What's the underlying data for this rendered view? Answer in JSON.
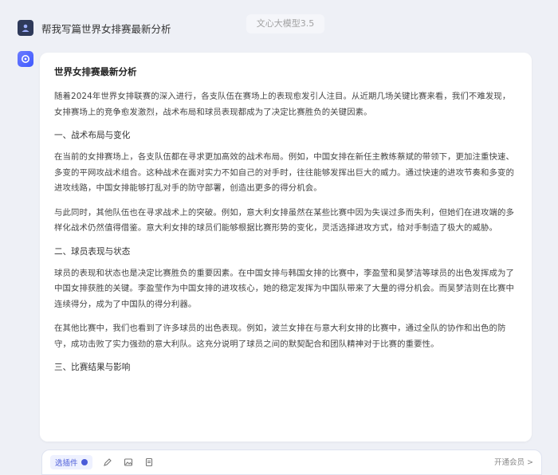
{
  "header": {
    "model_label": "文心大模型3.5"
  },
  "user": {
    "prompt": "帮我写篇世界女排赛最新分析"
  },
  "response": {
    "title": "世界女排赛最新分析",
    "intro": "随着2024年世界女排联赛的深入进行，各支队伍在赛场上的表现愈发引人注目。从近期几场关键比赛来看，我们不难发现，女排赛场上的竞争愈发激烈，战术布局和球员表现都成为了决定比赛胜负的关键因素。",
    "section1_heading": "一、战术布局与变化",
    "section1_p1": "在当前的女排赛场上，各支队伍都在寻求更加高效的战术布局。例如，中国女排在新任主教练蔡斌的带领下，更加注重快速、多变的平网攻战术组合。这种战术在面对实力不如自己的对手时，往往能够发挥出巨大的威力。通过快速的进攻节奏和多变的进攻线路，中国女排能够打乱对手的防守部署，创造出更多的得分机会。",
    "section1_p2": "与此同时，其他队伍也在寻求战术上的突破。例如，意大利女排虽然在某些比赛中因为失误过多而失利，但她们在进攻端的多样化战术仍然值得借鉴。意大利女排的球员们能够根据比赛形势的变化，灵活选择进攻方式，给对手制造了极大的威胁。",
    "section2_heading": "二、球员表现与状态",
    "section2_p1": "球员的表现和状态也是决定比赛胜负的重要因素。在中国女排与韩国女排的比赛中，李盈莹和吴梦洁等球员的出色发挥成为了中国女排获胜的关键。李盈莹作为中国女排的进攻核心，她的稳定发挥为中国队带来了大量的得分机会。而吴梦洁则在比赛中连续得分，成为了中国队的得分利器。",
    "section2_p2": "在其他比赛中，我们也看到了许多球员的出色表现。例如，波兰女排在与意大利女排的比赛中，通过全队的协作和出色的防守，成功击败了实力强劲的意大利队。这充分说明了球员之间的默契配合和团队精神对于比赛的重要性。",
    "section3_heading": "三、比赛结果与影响"
  },
  "input_bar": {
    "tool_label": "选插件",
    "right_label": "开通会员 >"
  }
}
